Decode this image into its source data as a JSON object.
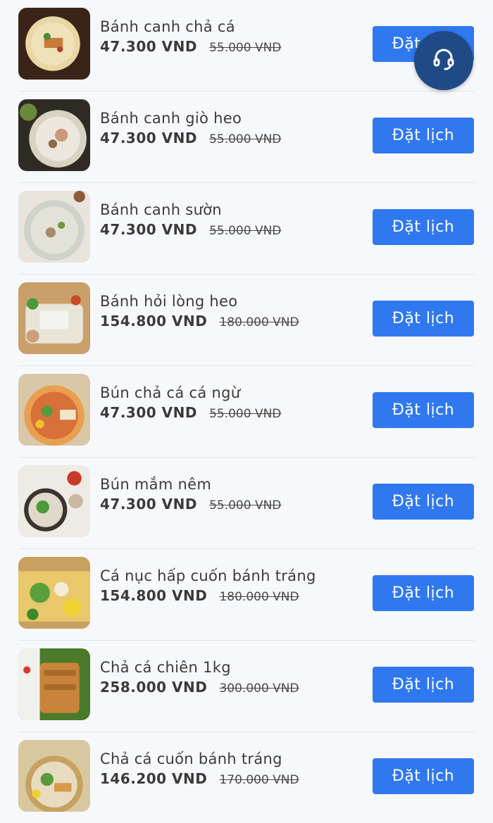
{
  "items": [
    {
      "name": "Bánh canh chả cá",
      "price": "47.300 VND",
      "old_price": "55.000 VND",
      "button": "Đặt lịch"
    },
    {
      "name": "Bánh canh giò heo",
      "price": "47.300 VND",
      "old_price": "55.000 VND",
      "button": "Đặt lịch"
    },
    {
      "name": "Bánh canh sườn",
      "price": "47.300 VND",
      "old_price": "55.000 VND",
      "button": "Đặt lịch"
    },
    {
      "name": "Bánh hỏi lòng heo",
      "price": "154.800 VND",
      "old_price": "180.000 VND",
      "button": "Đặt lịch"
    },
    {
      "name": "Bún chả cá cá ngừ",
      "price": "47.300 VND",
      "old_price": "55.000 VND",
      "button": "Đặt lịch"
    },
    {
      "name": "Bún mắm nêm",
      "price": "47.300 VND",
      "old_price": "55.000 VND",
      "button": "Đặt lịch"
    },
    {
      "name": "Cá nục hấp cuốn bánh tráng",
      "price": "154.800 VND",
      "old_price": "180.000 VND",
      "button": "Đặt lịch"
    },
    {
      "name": "Chả cá chiên 1kg",
      "price": "258.000 VND",
      "old_price": "300.000 VND",
      "button": "Đặt lịch"
    },
    {
      "name": "Chả cá cuốn bánh tráng",
      "price": "146.200 VND",
      "old_price": "170.000 VND",
      "button": "Đặt lịch"
    }
  ],
  "support_button": {
    "icon": "headset-icon"
  },
  "colors": {
    "accent": "#2f78f0",
    "support_bg": "#1f4a86"
  }
}
